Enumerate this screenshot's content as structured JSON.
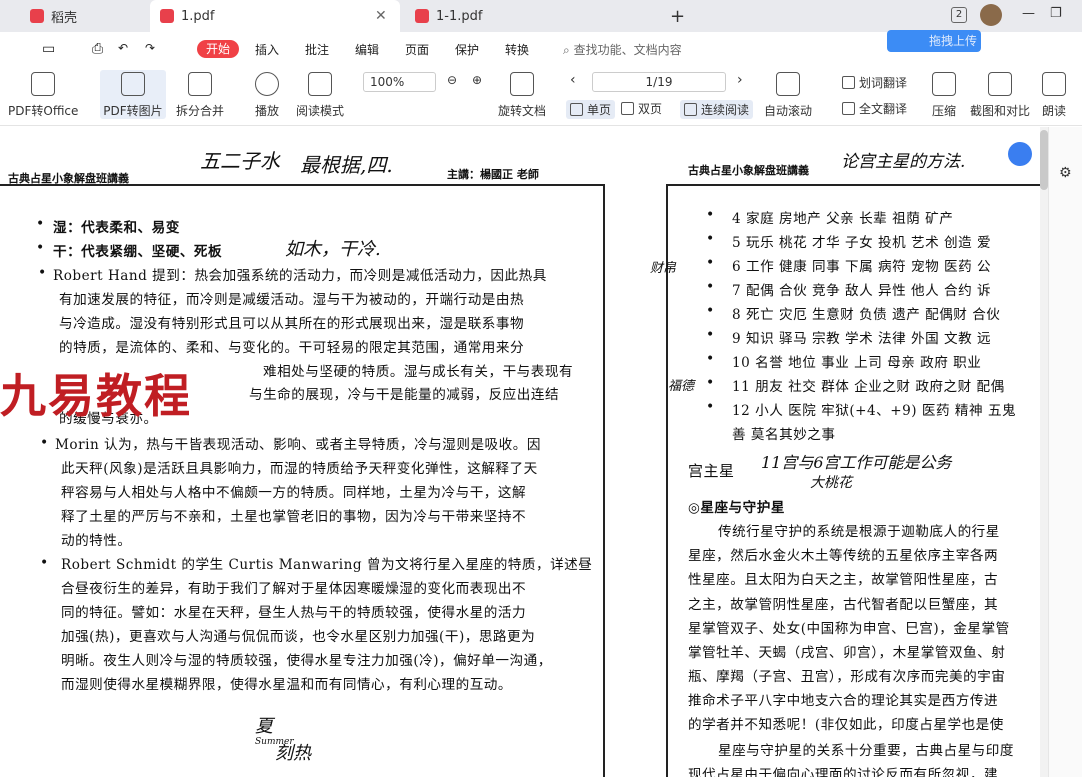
{
  "tabs": [
    {
      "label": "稻壳"
    },
    {
      "label": "1.pdf"
    },
    {
      "label": "1-1.pdf"
    }
  ],
  "titlebar": {
    "page_count_badge": "2"
  },
  "menu": {
    "start": "开始",
    "items": [
      "插入",
      "批注",
      "编辑",
      "页面",
      "保护",
      "转换"
    ],
    "search_placeholder": "查找功能、文档内容",
    "upload": "拖拽上传"
  },
  "toolbar": {
    "pdf_to_office": "PDF转Office",
    "pdf_to_image": "PDF转图片",
    "split_merge": "拆分合并",
    "play": "播放",
    "reading_mode": "阅读模式",
    "zoom": "100%",
    "page_indicator": "1/19",
    "rotate": "旋转文档",
    "auto_scroll": "自动滚动",
    "word_translate": "划词翻译",
    "full_translate": "全文翻译",
    "compress": "压缩",
    "screenshot_compare": "截图和对比",
    "read_aloud": "朗读",
    "single_page": "单页",
    "double_page": "双页",
    "continuous": "连续阅读"
  },
  "left_page": {
    "header": "古典占星小象解盘班講義",
    "lecturer": "主講：楊國正 老師",
    "lines": [
      "湿：代表柔和、易变",
      "干：代表紧绷、坚硬、死板",
      "Robert Hand 提到：热会加强系统的活动力，而冷则是减低活动力，因此热具",
      "有加速发展的特征，而冷则是减缓活动。湿与干为被动的，开端行动是由热",
      "与冷造成。湿没有特别形式且可以从其所在的形式展现出来，湿是联系事物",
      "的特质，是流体的、柔和、与变化的。干可轻易的限定其范围，通常用来分",
      "难相处与坚硬的特质。湿与成长有关，干与表现有",
      "与生命的展现，冷与干是能量的减弱，反应出连结",
      "的缓慢与衰亦。",
      "Morin 认为，热与干皆表现活动、影响、或者主导特质，冷与湿则是吸收。因",
      "此天秤(风象)是活跃且具影响力，而湿的特质给予天秤变化弹性，这解释了天",
      "秤容易与人相处与人格中不偏颇一方的特质。同样地，土星为冷与干，这解",
      "释了土星的严厉与不亲和，土星也掌管老旧的事物，因为冷与干带来坚持不",
      "动的特性。",
      "Robert Schmidt 的学生 Curtis Manwaring 曾为文将行星入星座的特质，详述昼",
      "合昼夜衍生的差异，有助于我们了解对于星体因寒暖燥湿的变化而表现出不",
      "同的特征。譬如：水星在天秤，昼生人热与干的特质较强，使得水星的活力",
      "加强(热)，更喜欢与人沟通与侃侃而谈，也令水星区别力加强(干)，思路更为",
      "明晰。夜生人则冷与湿的特质较强，使得水星专注力加强(冷)，偏好单一沟通，",
      "而湿则使得水星模糊界限，使得水星温和而有同情心，有利心理的互动。"
    ],
    "handwriting": [
      "五二子水",
      "最根据,四.",
      "如木，干冷.",
      "夏",
      "Summer",
      "刻热"
    ]
  },
  "right_page": {
    "header": "古典占星小象解盘班講義",
    "houses": [
      "4 家庭 房地产 父亲 长辈 祖荫 矿产",
      "5 玩乐 桃花 才华 子女 投机 艺术 创造 爱",
      "6 工作 健康 同事 下属 病符 宠物 医药 公",
      "7 配偶 合伙 竞争 敌人 异性 他人 合约 诉",
      "8 死亡 灾厄 生意财 负债 遗产 配偶财 合伙",
      "9 知识 驿马 宗教 学术 法律 外国 文教 远",
      "10 名誉 地位 事业 上司 母亲 政府 职业",
      "11 朋友 社交 群体 企业之财 政府之财 配偶",
      "12 小人 医院 牢狱(+4、+9) 医药 精神 五鬼"
    ],
    "extra": "善 莫名其妙之事",
    "section": "宫主星",
    "subsection": "◎星座与守护星",
    "body": [
      "传统行星守护的系统是根源于迦勒底人的行星",
      "星座，然后水金火木土等传统的五星依序主宰各两",
      "性星座。且太阳为白天之主，故掌管阳性星座，古",
      "之主，故掌管阴性星座，古代智者配以巨蟹座，其",
      "星掌管双子、处女(中国称为申宫、巳宫)，金星掌管",
      "掌管牡羊、天蝎（戌宫、卯宫），木星掌管双鱼、射",
      "瓶、摩羯（子宫、丑宫），形成有次序而完美的宇宙",
      "推命术子平八字中地支六合的理论其实是西方传进",
      "的学者并不知悉呢！(非仅如此，印度占星学也是使",
      "星座与守护星的关系十分重要，古典占星与印度",
      "现代占星由于偏向心理面的讨论反而有所忽视，建"
    ],
    "handwriting": [
      "论宫主星的方法.",
      "11宫与6宫工作可能是公务",
      "大桃花",
      "财帛",
      "福德"
    ]
  },
  "watermark": "九易教程"
}
